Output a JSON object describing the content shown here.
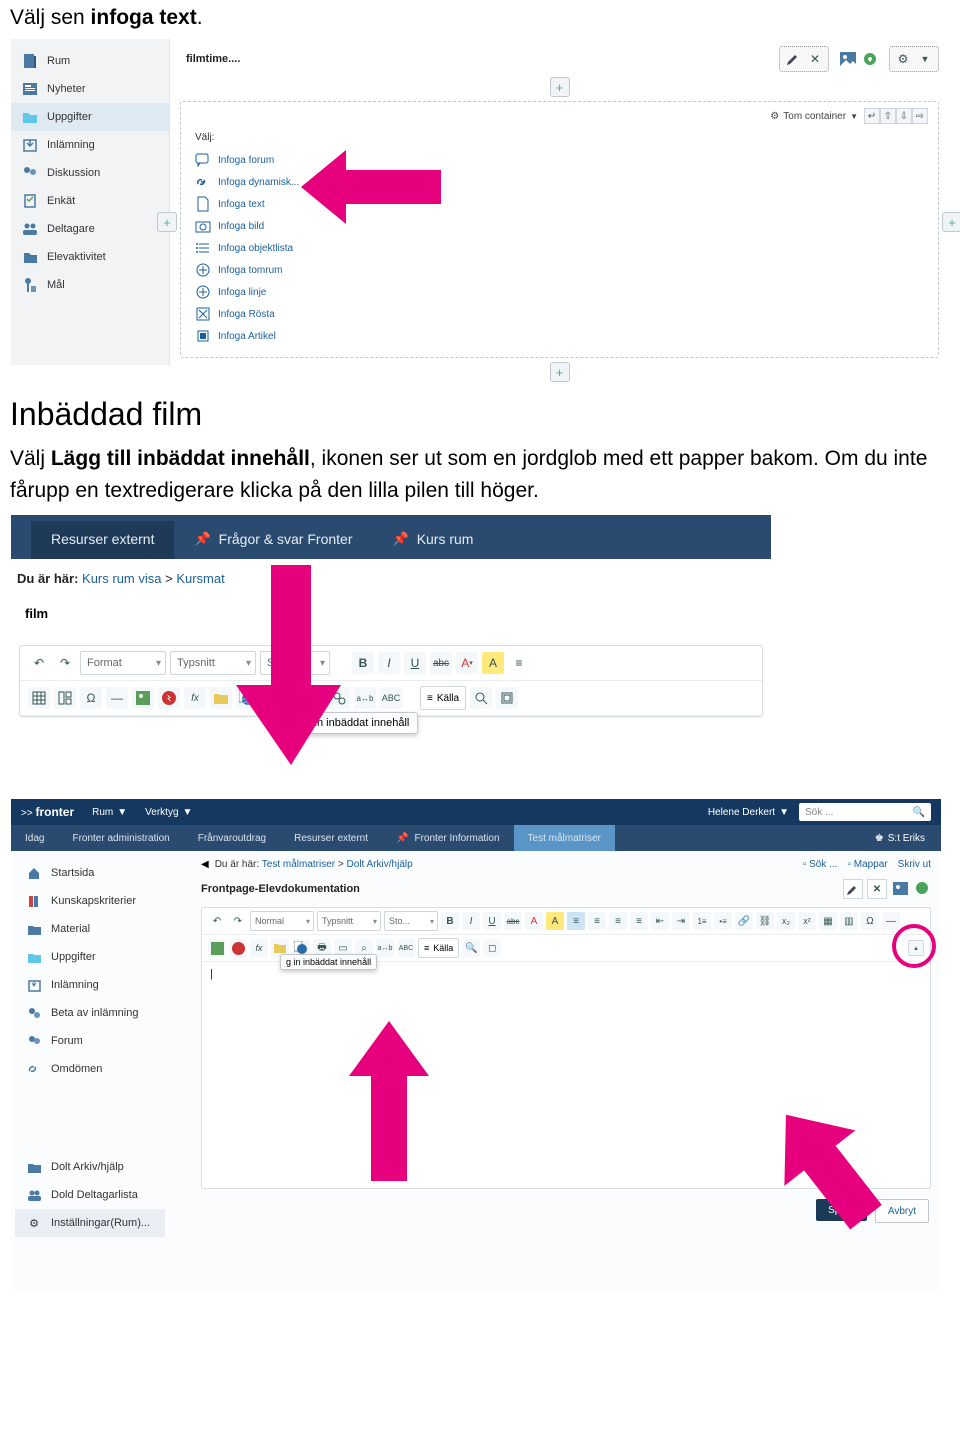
{
  "intro1_pre": "Välj sen ",
  "intro1_bold": "infoga text",
  "intro1_post": ".",
  "shot1": {
    "nav": [
      "Rum",
      "Nyheter",
      "Uppgifter",
      "Inlämning",
      "Diskussion",
      "Enkät",
      "Deltagare",
      "Elevaktivitet",
      "Mål"
    ],
    "title": "filmtime....",
    "container_label": "Tom container",
    "choose_label": "Välj:",
    "options": [
      "Infoga forum",
      "Infoga dynamisk...",
      "Infoga text",
      "Infoga bild",
      "Infoga objektlista",
      "Infoga tomrum",
      "Infoga linje",
      "Infoga Rösta",
      "Infoga Artikel"
    ]
  },
  "h2": "Inbäddad film",
  "para2_pre": "Välj ",
  "para2_bold": "Lägg till inbäddat innehåll",
  "para2_post": ", ikonen ser ut som en jordglob med ett papper bakom. Om du inte fårupp en textredigerare klicka på den lilla pilen till höger.",
  "shot2": {
    "tabs": [
      "Resurser externt",
      "Frågor & svar Fronter",
      "Kurs rum"
    ],
    "crumb_label": "Du är här:",
    "crumb1": "Kurs rum visa",
    "crumb2": "Kursmat",
    "film": "film",
    "format": "Format",
    "typsnitt": "Typsnitt",
    "size": "Sto...",
    "src": "Källa",
    "tooltip": "Lägg in inbäddat innehåll"
  },
  "shot3": {
    "brand": "fronter",
    "rum": "Rum",
    "verktyg": "Verktyg",
    "user": "Helene Derkert",
    "search": "Sök ...",
    "subtabs": [
      "Idag",
      "Fronter administration",
      "Frånvaroutdrag",
      "Resurser externt",
      "Fronter Information",
      "Test målmatriser"
    ],
    "erik": "S:t Eriks",
    "side1": [
      "Startsida",
      "Kunskapskriterier",
      "Material",
      "Uppgifter",
      "Inlämning",
      "Beta av inlämning",
      "Forum",
      "Omdömen"
    ],
    "side2": [
      "Dolt Arkiv/hjälp",
      "Dold Deltagarlista",
      "Inställningar(Rum)..."
    ],
    "crumb_label": "Du är här:",
    "crumb1": "Test målmatriser",
    "crumb2": "Dolt Arkiv/hjälp",
    "sok": "Sök ...",
    "mappar": "Mappar",
    "skriv": "Skriv ut",
    "fpage": "Frontpage-Elevdokumentation",
    "normal": "Normal",
    "typsnitt": "Typsnitt",
    "size": "Sto...",
    "src": "Källa",
    "tooltip": "g in inbäddat innehåll",
    "cursor": "|",
    "save": "Spara",
    "cancel": "Avbryt"
  }
}
